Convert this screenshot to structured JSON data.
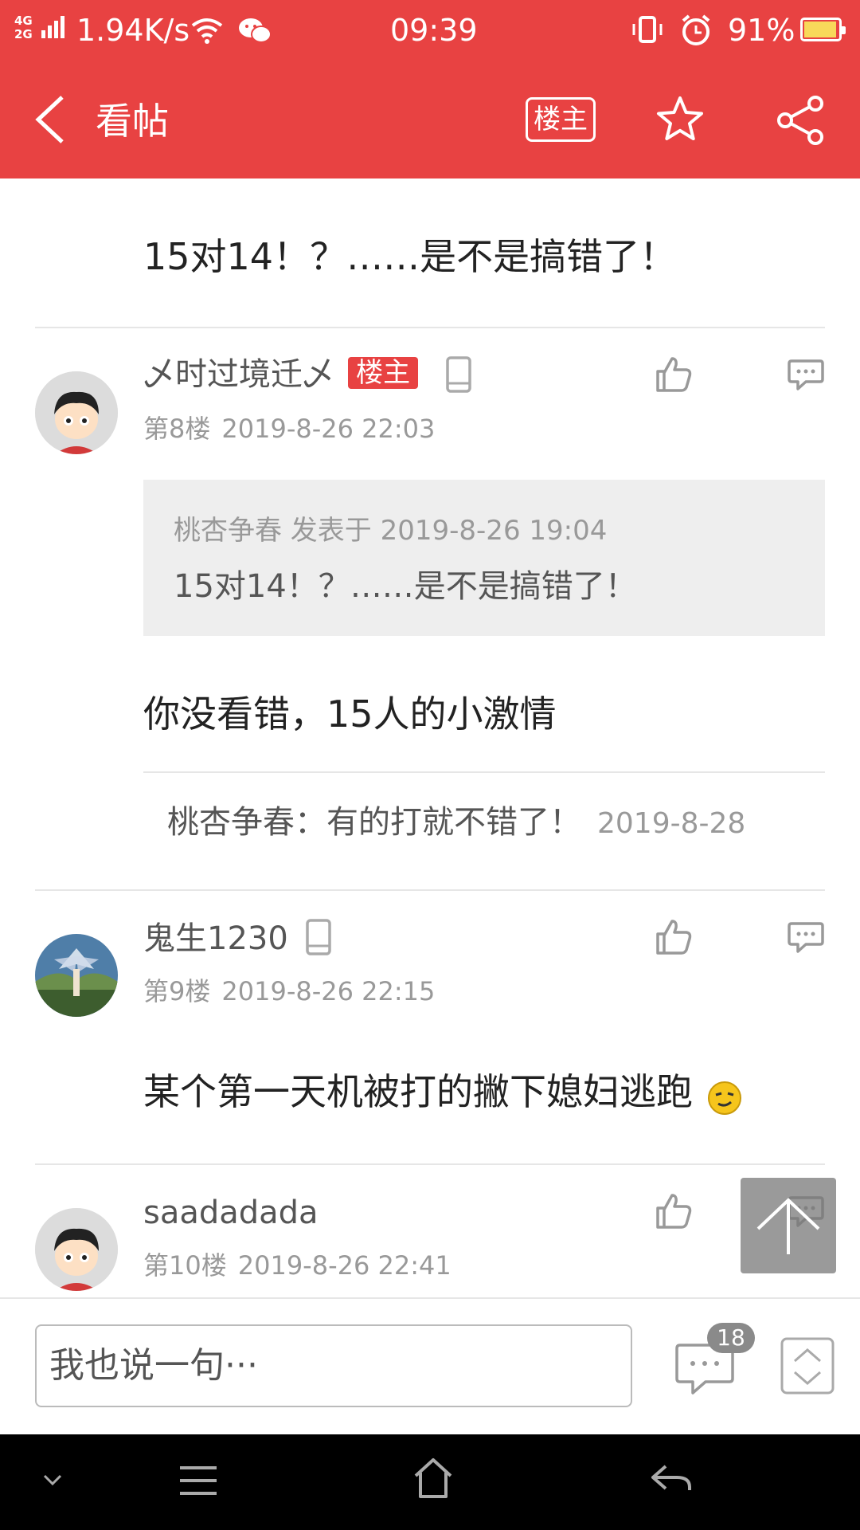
{
  "status_bar": {
    "network": "4G 2G",
    "speed": "1.94K/s",
    "time": "09:39",
    "battery": "91%",
    "battery_level": 0.91
  },
  "toolbar": {
    "title": "看帖",
    "op_button": "楼主"
  },
  "prev_post": {
    "text": "15对14！？……是不是搞错了！"
  },
  "posts": [
    {
      "username": "乄时过境迁乄",
      "badge": "楼主",
      "floor": "第8楼",
      "time": "2019-8-26 22:03",
      "quote": {
        "header": "桃杏争春 发表于 2019-8-26 19:04",
        "text": "15对14！？……是不是搞错了！"
      },
      "content": "你没看错，15人的小激情",
      "reply": {
        "author": "桃杏争春：",
        "text": "有的打就不错了！",
        "date": "2019-8-28"
      }
    },
    {
      "username": "鬼生1230",
      "floor": "第9楼",
      "time": "2019-8-26 22:15",
      "content": "某个第一天机被打的撇下媳妇逃跑"
    },
    {
      "username": "saadadada",
      "floor": "第10楼",
      "time": "2019-8-26 22:41"
    }
  ],
  "bottom_bar": {
    "input_placeholder": "我也说一句···",
    "comment_count": "18"
  },
  "colors": {
    "brand": "#e84242",
    "divider": "#e6e6e6",
    "quote_bg": "#eeeeee"
  },
  "icons": [
    "back-icon",
    "star-icon",
    "share-icon",
    "phone-icon",
    "like-icon",
    "comment-icon",
    "emoji-icon",
    "scroll-top-icon",
    "comment-count-icon",
    "page-nav-icon",
    "nav-down-icon",
    "nav-menu-icon",
    "nav-home-icon",
    "nav-back-icon"
  ]
}
